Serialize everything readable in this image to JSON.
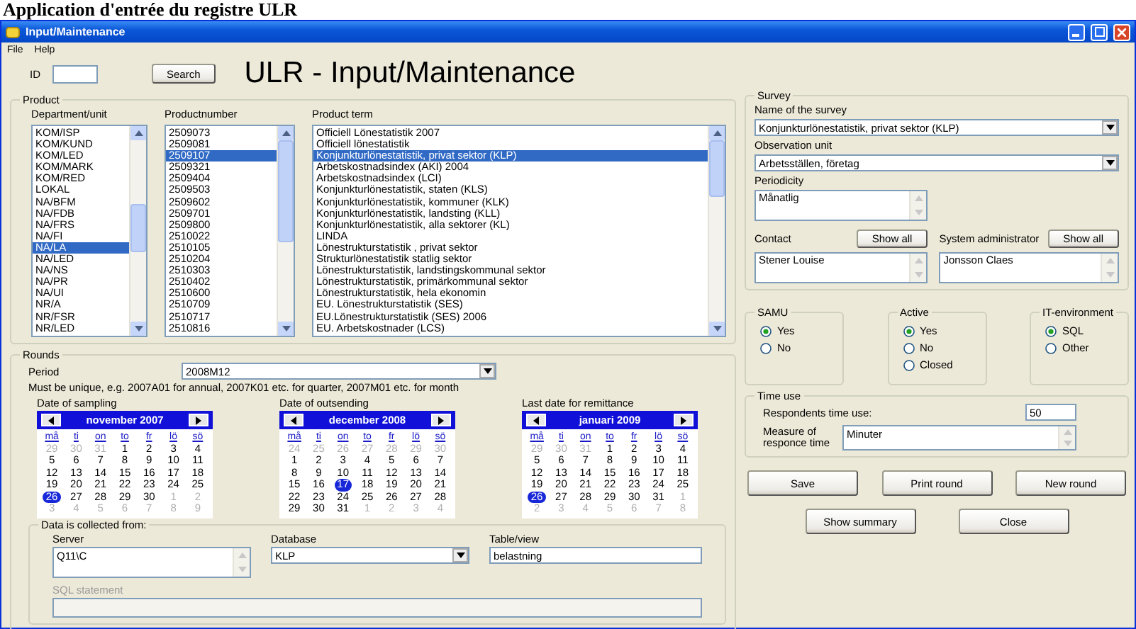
{
  "heading": "Application d'entrée du registre ULR",
  "window": {
    "title": "Input/Maintenance"
  },
  "menu": [
    "File",
    "Help"
  ],
  "id_field": {
    "label": "ID"
  },
  "search_button": "Search",
  "page_title": "ULR - Input/Maintenance",
  "product": {
    "title": "Product",
    "columns": [
      {
        "header": "Department/unit",
        "items": [
          {
            "label": "KOM/ISP",
            "selected": false
          },
          {
            "label": "KOM/KUND",
            "selected": false
          },
          {
            "label": "KOM/LED",
            "selected": false
          },
          {
            "label": "KOM/MARK",
            "selected": false
          },
          {
            "label": "KOM/RED",
            "selected": false
          },
          {
            "label": "LOKAL",
            "selected": false
          },
          {
            "label": "NA/BFM",
            "selected": false
          },
          {
            "label": "NA/FDB",
            "selected": false
          },
          {
            "label": "NA/FRS",
            "selected": false
          },
          {
            "label": "NA/FI",
            "selected": false
          },
          {
            "label": "NA/LA",
            "selected": true
          },
          {
            "label": "NA/LED",
            "selected": false
          },
          {
            "label": "NA/NS",
            "selected": false
          },
          {
            "label": "NA/PR",
            "selected": false
          },
          {
            "label": "NA/UI",
            "selected": false
          },
          {
            "label": "NR/A",
            "selected": false
          },
          {
            "label": "NR/FSR",
            "selected": false
          },
          {
            "label": "NR/LED",
            "selected": false
          }
        ]
      },
      {
        "header": "Productnumber",
        "items": [
          {
            "label": "2509073",
            "selected": false
          },
          {
            "label": "2509081",
            "selected": false
          },
          {
            "label": "2509107",
            "selected": true
          },
          {
            "label": "2509321",
            "selected": false
          },
          {
            "label": "2509404",
            "selected": false
          },
          {
            "label": "2509503",
            "selected": false
          },
          {
            "label": "2509602",
            "selected": false
          },
          {
            "label": "2509701",
            "selected": false
          },
          {
            "label": "2509800",
            "selected": false
          },
          {
            "label": "2510022",
            "selected": false
          },
          {
            "label": "2510105",
            "selected": false
          },
          {
            "label": "2510204",
            "selected": false
          },
          {
            "label": "2510303",
            "selected": false
          },
          {
            "label": "2510402",
            "selected": false
          },
          {
            "label": "2510600",
            "selected": false
          },
          {
            "label": "2510709",
            "selected": false
          },
          {
            "label": "2510717",
            "selected": false
          },
          {
            "label": "2510816",
            "selected": false
          }
        ]
      },
      {
        "header": "Product term",
        "items": [
          {
            "label": "Officiell Lönestatistik 2007",
            "selected": false
          },
          {
            "label": "Officiell lönestatistik",
            "selected": false
          },
          {
            "label": "Konjunkturlönestatistik, privat sektor (KLP)",
            "selected": true
          },
          {
            "label": "Arbetskostnadsindex (AKI) 2004",
            "selected": false
          },
          {
            "label": "Arbetskostnadsindex (LCI)",
            "selected": false
          },
          {
            "label": "Konjunkturlönestatistik, staten (KLS)",
            "selected": false
          },
          {
            "label": "Konjunkturlönestatistik, kommuner (KLK)",
            "selected": false
          },
          {
            "label": "Konjunkturlönestatistik, landsting (KLL)",
            "selected": false
          },
          {
            "label": "Konjunkturlönestatistik, alla sektorer (KL)",
            "selected": false
          },
          {
            "label": "LINDA",
            "selected": false
          },
          {
            "label": "Lönestrukturstatistik , privat sektor",
            "selected": false
          },
          {
            "label": "Strukturlönestatistik statlig sektor",
            "selected": false
          },
          {
            "label": "Lönestrukturstatistik, landstingskommunal sektor",
            "selected": false
          },
          {
            "label": "Lönestrukturstatistik, primärkommunal sektor",
            "selected": false
          },
          {
            "label": "Lönestrukturstatistik, hela ekonomin",
            "selected": false
          },
          {
            "label": "EU. Lönestrukturstatistik (SES)",
            "selected": false
          },
          {
            "label": "EU.Lönestrukturstatistik (SES) 2006",
            "selected": false
          },
          {
            "label": "EU. Arbetskostnader (LCS)",
            "selected": false
          }
        ]
      }
    ]
  },
  "rounds": {
    "title": "Rounds",
    "period": {
      "label": "Period",
      "value": "2008M12"
    },
    "hint": "Must be unique, e.g. 2007A01 for annual, 2007K01 etc. for quarter, 2007M01 etc. for month",
    "calendars": [
      {
        "label": "Date of sampling",
        "month": "november 2007",
        "weekdays": [
          "må",
          "ti",
          "on",
          "to",
          "fr",
          "lö",
          "sö"
        ],
        "weeks": [
          [
            {
              "day": "29",
              "muted": true,
              "selected": false
            },
            {
              "day": "30",
              "muted": true,
              "selected": false
            },
            {
              "day": "31",
              "muted": true,
              "selected": false
            },
            {
              "day": "1",
              "muted": false,
              "selected": false
            },
            {
              "day": "2",
              "muted": false,
              "selected": false
            },
            {
              "day": "3",
              "muted": false,
              "selected": false
            },
            {
              "day": "4",
              "muted": false,
              "selected": false
            }
          ],
          [
            {
              "day": "5",
              "muted": false,
              "selected": false
            },
            {
              "day": "6",
              "muted": false,
              "selected": false
            },
            {
              "day": "7",
              "muted": false,
              "selected": false
            },
            {
              "day": "8",
              "muted": false,
              "selected": false
            },
            {
              "day": "9",
              "muted": false,
              "selected": false
            },
            {
              "day": "10",
              "muted": false,
              "selected": false
            },
            {
              "day": "11",
              "muted": false,
              "selected": false
            }
          ],
          [
            {
              "day": "12",
              "muted": false,
              "selected": false
            },
            {
              "day": "13",
              "muted": false,
              "selected": false
            },
            {
              "day": "14",
              "muted": false,
              "selected": false
            },
            {
              "day": "15",
              "muted": false,
              "selected": false
            },
            {
              "day": "16",
              "muted": false,
              "selected": false
            },
            {
              "day": "17",
              "muted": false,
              "selected": false
            },
            {
              "day": "18",
              "muted": false,
              "selected": false
            }
          ],
          [
            {
              "day": "19",
              "muted": false,
              "selected": false
            },
            {
              "day": "20",
              "muted": false,
              "selected": false
            },
            {
              "day": "21",
              "muted": false,
              "selected": false
            },
            {
              "day": "22",
              "muted": false,
              "selected": false
            },
            {
              "day": "23",
              "muted": false,
              "selected": false
            },
            {
              "day": "24",
              "muted": false,
              "selected": false
            },
            {
              "day": "25",
              "muted": false,
              "selected": false
            }
          ],
          [
            {
              "day": "26",
              "muted": false,
              "selected": true
            },
            {
              "day": "27",
              "muted": false,
              "selected": false
            },
            {
              "day": "28",
              "muted": false,
              "selected": false
            },
            {
              "day": "29",
              "muted": false,
              "selected": false
            },
            {
              "day": "30",
              "muted": false,
              "selected": false
            },
            {
              "day": "1",
              "muted": true,
              "selected": false
            },
            {
              "day": "2",
              "muted": true,
              "selected": false
            }
          ],
          [
            {
              "day": "3",
              "muted": true,
              "selected": false
            },
            {
              "day": "4",
              "muted": true,
              "selected": false
            },
            {
              "day": "5",
              "muted": true,
              "selected": false
            },
            {
              "day": "6",
              "muted": true,
              "selected": false
            },
            {
              "day": "7",
              "muted": true,
              "selected": false
            },
            {
              "day": "8",
              "muted": true,
              "selected": false
            },
            {
              "day": "9",
              "muted": true,
              "selected": false
            }
          ]
        ]
      },
      {
        "label": "Date of outsending",
        "month": "december 2008",
        "weekdays": [
          "må",
          "ti",
          "on",
          "to",
          "fr",
          "lö",
          "sö"
        ],
        "weeks": [
          [
            {
              "day": "24",
              "muted": true,
              "selected": false
            },
            {
              "day": "25",
              "muted": true,
              "selected": false
            },
            {
              "day": "26",
              "muted": true,
              "selected": false
            },
            {
              "day": "27",
              "muted": true,
              "selected": false
            },
            {
              "day": "28",
              "muted": true,
              "selected": false
            },
            {
              "day": "29",
              "muted": true,
              "selected": false
            },
            {
              "day": "30",
              "muted": true,
              "selected": false
            }
          ],
          [
            {
              "day": "1",
              "muted": false,
              "selected": false
            },
            {
              "day": "2",
              "muted": false,
              "selected": false
            },
            {
              "day": "3",
              "muted": false,
              "selected": false
            },
            {
              "day": "4",
              "muted": false,
              "selected": false
            },
            {
              "day": "5",
              "muted": false,
              "selected": false
            },
            {
              "day": "6",
              "muted": false,
              "selected": false
            },
            {
              "day": "7",
              "muted": false,
              "selected": false
            }
          ],
          [
            {
              "day": "8",
              "muted": false,
              "selected": false
            },
            {
              "day": "9",
              "muted": false,
              "selected": false
            },
            {
              "day": "10",
              "muted": false,
              "selected": false
            },
            {
              "day": "11",
              "muted": false,
              "selected": false
            },
            {
              "day": "12",
              "muted": false,
              "selected": false
            },
            {
              "day": "13",
              "muted": false,
              "selected": false
            },
            {
              "day": "14",
              "muted": false,
              "selected": false
            }
          ],
          [
            {
              "day": "15",
              "muted": false,
              "selected": false
            },
            {
              "day": "16",
              "muted": false,
              "selected": false
            },
            {
              "day": "17",
              "muted": false,
              "selected": true
            },
            {
              "day": "18",
              "muted": false,
              "selected": false
            },
            {
              "day": "19",
              "muted": false,
              "selected": false
            },
            {
              "day": "20",
              "muted": false,
              "selected": false
            },
            {
              "day": "21",
              "muted": false,
              "selected": false
            }
          ],
          [
            {
              "day": "22",
              "muted": false,
              "selected": false
            },
            {
              "day": "23",
              "muted": false,
              "selected": false
            },
            {
              "day": "24",
              "muted": false,
              "selected": false
            },
            {
              "day": "25",
              "muted": false,
              "selected": false
            },
            {
              "day": "26",
              "muted": false,
              "selected": false
            },
            {
              "day": "27",
              "muted": false,
              "selected": false
            },
            {
              "day": "28",
              "muted": false,
              "selected": false
            }
          ],
          [
            {
              "day": "29",
              "muted": false,
              "selected": false
            },
            {
              "day": "30",
              "muted": false,
              "selected": false
            },
            {
              "day": "31",
              "muted": false,
              "selected": false
            },
            {
              "day": "1",
              "muted": true,
              "selected": false
            },
            {
              "day": "2",
              "muted": true,
              "selected": false
            },
            {
              "day": "3",
              "muted": true,
              "selected": false
            },
            {
              "day": "4",
              "muted": true,
              "selected": false
            }
          ]
        ]
      },
      {
        "label": "Last date for remittance",
        "month": "januari 2009",
        "weekdays": [
          "må",
          "ti",
          "on",
          "to",
          "fr",
          "lö",
          "sö"
        ],
        "weeks": [
          [
            {
              "day": "29",
              "muted": true,
              "selected": false
            },
            {
              "day": "30",
              "muted": true,
              "selected": false
            },
            {
              "day": "31",
              "muted": true,
              "selected": false
            },
            {
              "day": "1",
              "muted": false,
              "selected": false
            },
            {
              "day": "2",
              "muted": false,
              "selected": false
            },
            {
              "day": "3",
              "muted": false,
              "selected": false
            },
            {
              "day": "4",
              "muted": false,
              "selected": false
            }
          ],
          [
            {
              "day": "5",
              "muted": false,
              "selected": false
            },
            {
              "day": "6",
              "muted": false,
              "selected": false
            },
            {
              "day": "7",
              "muted": false,
              "selected": false
            },
            {
              "day": "8",
              "muted": false,
              "selected": false
            },
            {
              "day": "9",
              "muted": false,
              "selected": false
            },
            {
              "day": "10",
              "muted": false,
              "selected": false
            },
            {
              "day": "11",
              "muted": false,
              "selected": false
            }
          ],
          [
            {
              "day": "12",
              "muted": false,
              "selected": false
            },
            {
              "day": "13",
              "muted": false,
              "selected": false
            },
            {
              "day": "14",
              "muted": false,
              "selected": false
            },
            {
              "day": "15",
              "muted": false,
              "selected": false
            },
            {
              "day": "16",
              "muted": false,
              "selected": false
            },
            {
              "day": "17",
              "muted": false,
              "selected": false
            },
            {
              "day": "18",
              "muted": false,
              "selected": false
            }
          ],
          [
            {
              "day": "19",
              "muted": false,
              "selected": false
            },
            {
              "day": "20",
              "muted": false,
              "selected": false
            },
            {
              "day": "21",
              "muted": false,
              "selected": false
            },
            {
              "day": "22",
              "muted": false,
              "selected": false
            },
            {
              "day": "23",
              "muted": false,
              "selected": false
            },
            {
              "day": "24",
              "muted": false,
              "selected": false
            },
            {
              "day": "25",
              "muted": false,
              "selected": false
            }
          ],
          [
            {
              "day": "26",
              "muted": false,
              "selected": true
            },
            {
              "day": "27",
              "muted": false,
              "selected": false
            },
            {
              "day": "28",
              "muted": false,
              "selected": false
            },
            {
              "day": "29",
              "muted": false,
              "selected": false
            },
            {
              "day": "30",
              "muted": false,
              "selected": false
            },
            {
              "day": "31",
              "muted": false,
              "selected": false
            },
            {
              "day": "1",
              "muted": true,
              "selected": false
            }
          ],
          [
            {
              "day": "2",
              "muted": true,
              "selected": false
            },
            {
              "day": "3",
              "muted": true,
              "selected": false
            },
            {
              "day": "4",
              "muted": true,
              "selected": false
            },
            {
              "day": "5",
              "muted": true,
              "selected": false
            },
            {
              "day": "6",
              "muted": true,
              "selected": false
            },
            {
              "day": "7",
              "muted": true,
              "selected": false
            },
            {
              "day": "8",
              "muted": true,
              "selected": false
            }
          ]
        ]
      }
    ],
    "data_source": {
      "title": "Data is collected from:",
      "server": {
        "label": "Server",
        "value": "Q11\\C"
      },
      "database": {
        "label": "Database",
        "value": "KLP"
      },
      "table": {
        "label": "Table/view",
        "value": "belastning"
      },
      "sql": {
        "label": "SQL statement",
        "disabled": true
      }
    }
  },
  "survey": {
    "title": "Survey",
    "name": {
      "label": "Name of the survey",
      "value": "Konjunkturlönestatistik, privat sektor (KLP)"
    },
    "observation_unit": {
      "label": "Observation unit",
      "value": "Arbetsställen, företag"
    },
    "periodicity": {
      "label": "Periodicity",
      "items": [
        "Månatlig"
      ]
    },
    "people": [
      {
        "label": "Contact",
        "button": "Show all",
        "items": [
          "Stener Louise"
        ]
      },
      {
        "label": "System administrator",
        "button": "Show all",
        "items": [
          "Jonsson Claes"
        ]
      }
    ]
  },
  "radio_groups": [
    {
      "title": "SAMU",
      "options": [
        {
          "label": "Yes",
          "selected": true
        },
        {
          "label": "No",
          "selected": false
        }
      ]
    },
    {
      "title": "Active",
      "options": [
        {
          "label": "Yes",
          "selected": true
        },
        {
          "label": "No",
          "selected": false
        },
        {
          "label": "Closed",
          "selected": false
        }
      ]
    },
    {
      "title": "IT-environment",
      "options": [
        {
          "label": "SQL",
          "selected": true
        },
        {
          "label": "Other",
          "selected": false
        }
      ]
    }
  ],
  "time_use": {
    "title": "Time use",
    "respondents": {
      "label": "Respondents time use:",
      "value": "50"
    },
    "measure": {
      "label": "Measure of responce time",
      "value": "Minuter"
    }
  },
  "button_rows": [
    [
      "Save",
      "Print round",
      "New round"
    ],
    [
      "Show summary",
      "Close"
    ]
  ]
}
